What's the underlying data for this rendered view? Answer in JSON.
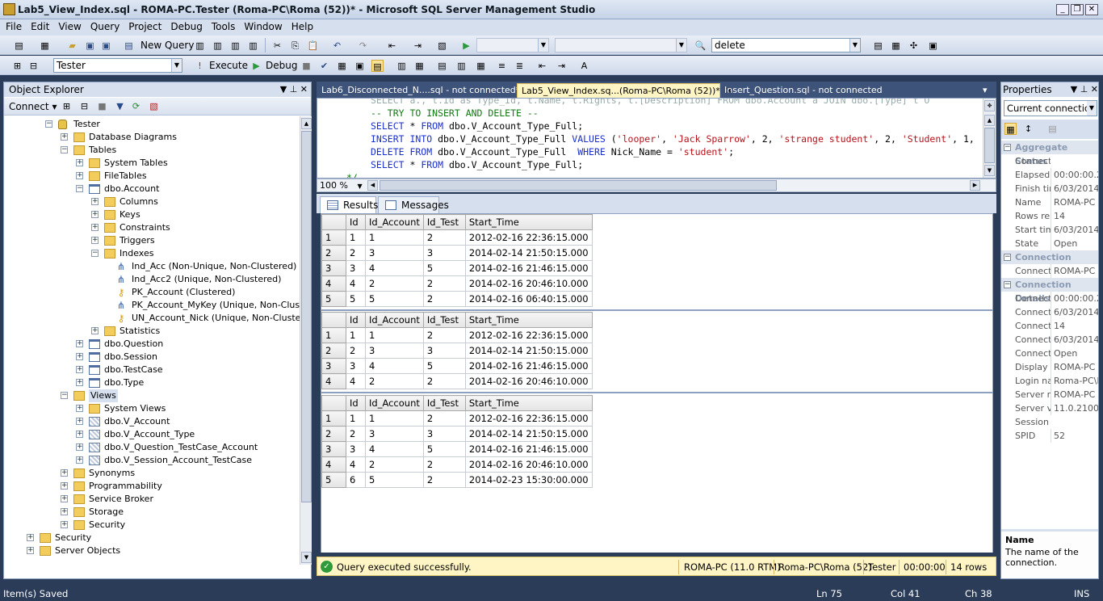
{
  "window": {
    "title": "Lab5_View_Index.sql - ROMA-PC.Tester (Roma-PC\\Roma (52))* - Microsoft SQL Server Management Studio"
  },
  "menu": [
    "File",
    "Edit",
    "View",
    "Query",
    "Project",
    "Debug",
    "Tools",
    "Window",
    "Help"
  ],
  "toolbar1": {
    "new_query": "New Query",
    "search_value": "delete"
  },
  "toolbar2": {
    "database": "Tester",
    "execute": "Execute",
    "debug": "Debug"
  },
  "object_explorer": {
    "title": "Object Explorer",
    "connect": "Connect",
    "tree": [
      {
        "label": "Tester",
        "level": 0,
        "icon": "database-icon",
        "exp": "−"
      },
      {
        "label": "Database Diagrams",
        "level": 1,
        "icon": "folder-icon",
        "exp": "+"
      },
      {
        "label": "Tables",
        "level": 1,
        "icon": "folder-icon",
        "exp": "−"
      },
      {
        "label": "System Tables",
        "level": 2,
        "icon": "folder-icon",
        "exp": "+"
      },
      {
        "label": "FileTables",
        "level": 2,
        "icon": "folder-icon",
        "exp": "+"
      },
      {
        "label": "dbo.Account",
        "level": 2,
        "icon": "table-icon",
        "exp": "−"
      },
      {
        "label": "Columns",
        "level": 3,
        "icon": "folder-icon",
        "exp": "+"
      },
      {
        "label": "Keys",
        "level": 3,
        "icon": "folder-icon",
        "exp": "+"
      },
      {
        "label": "Constraints",
        "level": 3,
        "icon": "folder-icon",
        "exp": "+"
      },
      {
        "label": "Triggers",
        "level": 3,
        "icon": "folder-icon",
        "exp": "+"
      },
      {
        "label": "Indexes",
        "level": 3,
        "icon": "folder-icon",
        "exp": "−"
      },
      {
        "label": "Ind_Acc (Non-Unique, Non-Clustered)",
        "level": 4,
        "icon": "index-icon",
        "exp": ""
      },
      {
        "label": "Ind_Acc2 (Unique, Non-Clustered)",
        "level": 4,
        "icon": "index-icon",
        "exp": ""
      },
      {
        "label": "PK_Account (Clustered)",
        "level": 4,
        "icon": "key-icon",
        "exp": ""
      },
      {
        "label": "PK_Account_MyKey (Unique, Non-Clustere",
        "level": 4,
        "icon": "index-icon",
        "exp": ""
      },
      {
        "label": "UN_Account_Nick (Unique, Non-Clustered)",
        "level": 4,
        "icon": "key-icon",
        "exp": ""
      },
      {
        "label": "Statistics",
        "level": 3,
        "icon": "folder-icon",
        "exp": "+"
      },
      {
        "label": "dbo.Question",
        "level": 2,
        "icon": "table-icon",
        "exp": "+"
      },
      {
        "label": "dbo.Session",
        "level": 2,
        "icon": "table-icon",
        "exp": "+"
      },
      {
        "label": "dbo.TestCase",
        "level": 2,
        "icon": "table-icon",
        "exp": "+"
      },
      {
        "label": "dbo.Type",
        "level": 2,
        "icon": "table-icon",
        "exp": "+"
      },
      {
        "label": "Views",
        "level": 1,
        "icon": "folder-icon",
        "exp": "−",
        "selected": true
      },
      {
        "label": "System Views",
        "level": 2,
        "icon": "folder-icon",
        "exp": "+"
      },
      {
        "label": "dbo.V_Account",
        "level": 2,
        "icon": "view-icon",
        "exp": "+"
      },
      {
        "label": "dbo.V_Account_Type",
        "level": 2,
        "icon": "view-icon",
        "exp": "+"
      },
      {
        "label": "dbo.V_Question_TestCase_Account",
        "level": 2,
        "icon": "view-icon",
        "exp": "+"
      },
      {
        "label": "dbo.V_Session_Account_TestCase",
        "level": 2,
        "icon": "view-icon",
        "exp": "+"
      },
      {
        "label": "Synonyms",
        "level": 1,
        "icon": "folder-icon",
        "exp": "+"
      },
      {
        "label": "Programmability",
        "level": 1,
        "icon": "folder-icon",
        "exp": "+"
      },
      {
        "label": "Service Broker",
        "level": 1,
        "icon": "folder-icon",
        "exp": "+"
      },
      {
        "label": "Storage",
        "level": 1,
        "icon": "folder-icon",
        "exp": "+"
      },
      {
        "label": "Security",
        "level": 1,
        "icon": "folder-icon",
        "exp": "+"
      },
      {
        "label": "Security",
        "level": -1,
        "icon": "folder-icon",
        "exp": "+"
      },
      {
        "label": "Server Objects",
        "level": -1,
        "icon": "folder-icon",
        "exp": "+"
      }
    ]
  },
  "tabs": [
    {
      "label": "Lab6_Disconnected_N....sql - not connected*",
      "active": false
    },
    {
      "label": "Lab5_View_Index.sq...(Roma-PC\\Roma (52))*",
      "active": true
    },
    {
      "label": "Insert_Question.sql - not connected",
      "active": false
    }
  ],
  "editor": {
    "lines": [
      "-- TRY TO INSERT AND DELETE --",
      "SELECT * FROM dbo.V_Account_Type_Full;",
      "INSERT INTO dbo.V_Account_Type_Full VALUES ('looper', 'Jack Sparrow', 2, 'strange student', 2, 'Student', 1,",
      "DELETE FROM dbo.V_Account_Type_Full  WHERE Nick_Name = 'student';",
      "SELECT * FROM dbo.V_Account_Type_Full;",
      "*/"
    ],
    "zoom": "100 %"
  },
  "result_tabs": {
    "results": "Results",
    "messages": "Messages"
  },
  "grids": [
    {
      "columns": [
        "Id",
        "Id_Account",
        "Id_Test",
        "Start_Time"
      ],
      "rows": [
        [
          "1",
          "1",
          "1",
          "2",
          "2012-02-16 22:36:15.000"
        ],
        [
          "2",
          "2",
          "3",
          "3",
          "2014-02-14 21:50:15.000"
        ],
        [
          "3",
          "3",
          "4",
          "5",
          "2014-02-16 21:46:15.000"
        ],
        [
          "4",
          "4",
          "2",
          "2",
          "2014-02-16 20:46:10.000"
        ],
        [
          "5",
          "5",
          "5",
          "2",
          "2014-02-16 06:40:15.000"
        ]
      ]
    },
    {
      "columns": [
        "Id",
        "Id_Account",
        "Id_Test",
        "Start_Time"
      ],
      "rows": [
        [
          "1",
          "1",
          "1",
          "2",
          "2012-02-16 22:36:15.000"
        ],
        [
          "2",
          "2",
          "3",
          "3",
          "2014-02-14 21:50:15.000"
        ],
        [
          "3",
          "3",
          "4",
          "5",
          "2014-02-16 21:46:15.000"
        ],
        [
          "4",
          "4",
          "2",
          "2",
          "2014-02-16 20:46:10.000"
        ]
      ]
    },
    {
      "columns": [
        "Id",
        "Id_Account",
        "Id_Test",
        "Start_Time"
      ],
      "rows": [
        [
          "1",
          "1",
          "1",
          "2",
          "2012-02-16 22:36:15.000"
        ],
        [
          "2",
          "2",
          "3",
          "3",
          "2014-02-14 21:50:15.000"
        ],
        [
          "3",
          "3",
          "4",
          "5",
          "2014-02-16 21:46:15.000"
        ],
        [
          "4",
          "4",
          "2",
          "2",
          "2014-02-16 20:46:10.000"
        ],
        [
          "5",
          "6",
          "5",
          "2",
          "2014-02-23 15:30:00.000"
        ]
      ]
    }
  ],
  "query_status": {
    "message": "Query executed successfully.",
    "server": "ROMA-PC (11.0 RTM)",
    "login": "Roma-PC\\Roma (52)",
    "db": "Tester",
    "time": "00:00:00",
    "rows": "14 rows"
  },
  "properties": {
    "title": "Properties",
    "selector": "Current connection",
    "sections": [
      {
        "name": "Aggregate Status",
        "rows": [
          [
            "Connect",
            ""
          ],
          [
            "Elapsed",
            "00:00:00.28"
          ],
          [
            "Finish tim",
            "6/03/2014 1"
          ],
          [
            "Name",
            "ROMA-PC"
          ],
          [
            "Rows re",
            "14"
          ],
          [
            "Start tim",
            "6/03/2014 1"
          ],
          [
            "State",
            "Open"
          ]
        ]
      },
      {
        "name": "Connection",
        "rows": [
          [
            "Connect",
            "ROMA-PC (R"
          ]
        ]
      },
      {
        "name": "Connection Details",
        "rows": [
          [
            "Connect",
            "00:00:00.28"
          ],
          [
            "Connect",
            "6/03/2014 1"
          ],
          [
            "Connect",
            "14"
          ],
          [
            "Connect",
            "6/03/2014 1"
          ],
          [
            "Connect",
            "Open"
          ],
          [
            "Display",
            "ROMA-PC"
          ],
          [
            "Login na",
            "Roma-PC\\Ro"
          ],
          [
            "Server r",
            "ROMA-PC"
          ],
          [
            "Server v",
            "11.0.2100"
          ],
          [
            "Session",
            ""
          ],
          [
            "SPID",
            "52"
          ]
        ]
      }
    ],
    "desc_title": "Name",
    "desc_text": "The name of the connection."
  },
  "statusbar": {
    "left": "Item(s) Saved",
    "ln": "Ln 75",
    "col": "Col 41",
    "ch": "Ch 38",
    "ins": "INS"
  }
}
